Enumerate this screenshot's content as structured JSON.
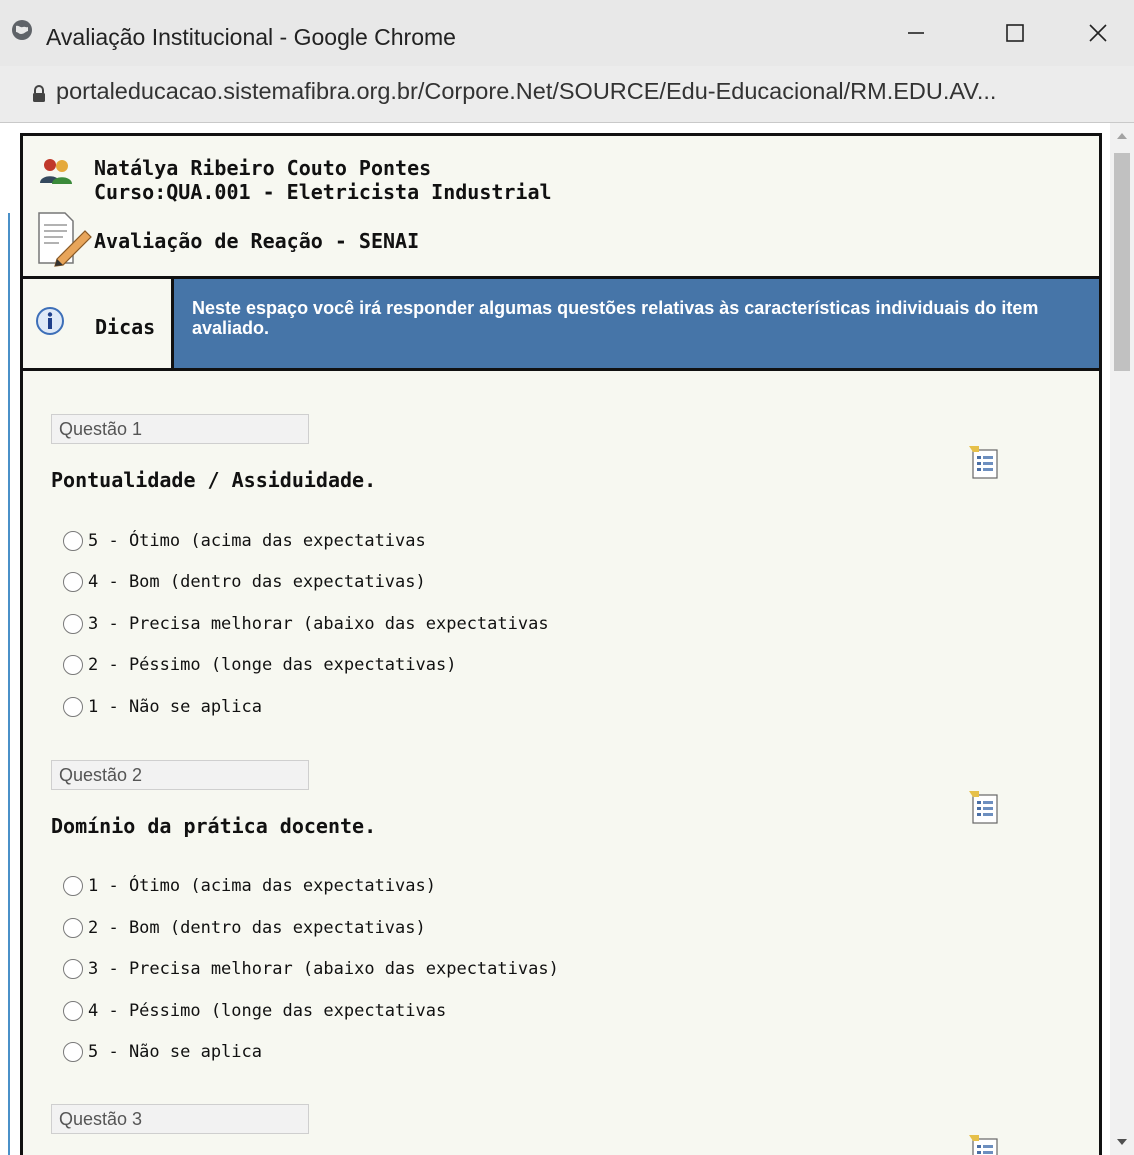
{
  "window": {
    "title": "Avaliação Institucional - Google Chrome",
    "url": "portaleducacao.sistemafibra.org.br/Corpore.Net/SOURCE/Edu-Educacional/RM.EDU.AV..."
  },
  "header": {
    "student_name": "Natálya Ribeiro Couto Pontes",
    "course": "Curso:QUA.001 - Eletricista Industrial",
    "evaluation_title": "Avaliação de Reação - SENAI"
  },
  "tips": {
    "label": "Dicas",
    "text": "Neste espaço você irá responder algumas questões relativas às características individuais do item avaliado."
  },
  "questions": [
    {
      "label": "Questão 1",
      "title": "Pontualidade / Assiduidade.",
      "options": [
        "5 - Ótimo (acima das expectativas",
        "4 - Bom (dentro das expectativas)",
        "3 - Precisa melhorar (abaixo das expectativas",
        "2 - Péssimo (longe das expectativas)",
        "1 - Não se aplica"
      ]
    },
    {
      "label": "Questão 2",
      "title": "Domínio da prática docente.",
      "options": [
        "1 - Ótimo (acima das expectativas)",
        "2 - Bom (dentro das expectativas)",
        "3 - Precisa melhorar (abaixo das expectativas)",
        "4 - Péssimo (longe das expectativas",
        "5 - Não se aplica"
      ]
    },
    {
      "label": "Questão 3"
    }
  ],
  "colors": {
    "tips_background": "#4675a8",
    "page_background": "#f7f8f1",
    "frame_border": "#111111"
  },
  "icons": {
    "browser": "globe-icon",
    "secure": "lock-icon",
    "user": "users-icon",
    "document": "document-edit-icon",
    "tips": "info-icon",
    "question": "question-list-icon"
  }
}
